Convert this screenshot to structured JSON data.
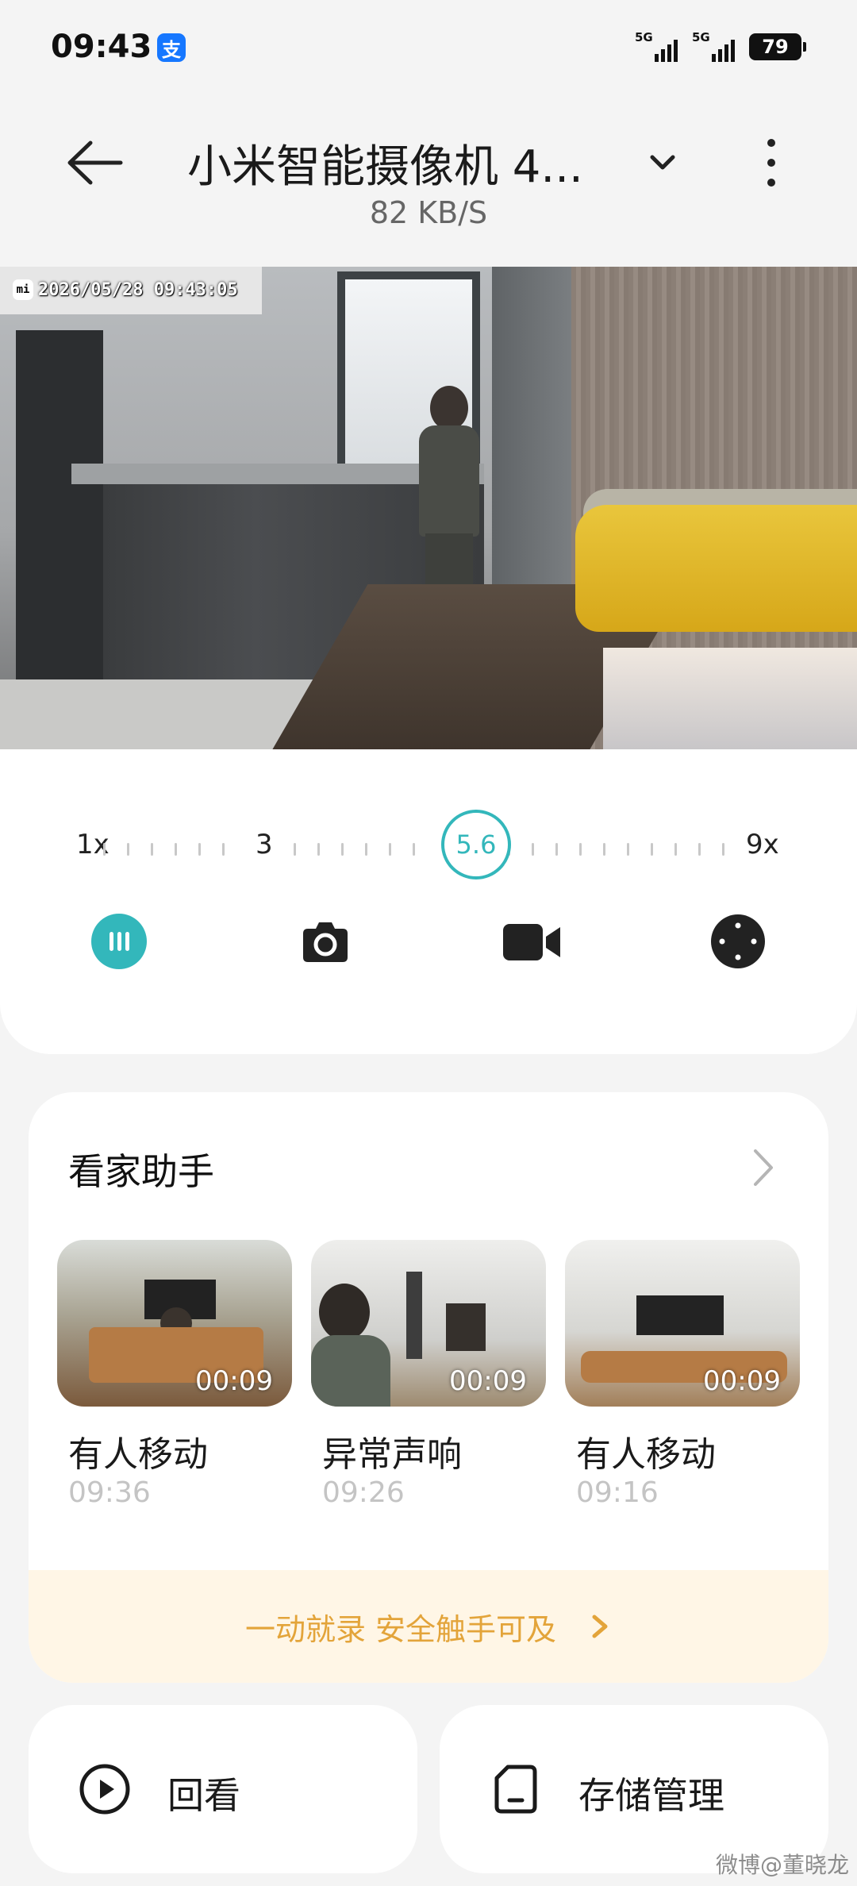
{
  "status_bar": {
    "time": "09:43",
    "app_badge": "支",
    "signal_1": "5G",
    "signal_2": "5G",
    "battery": "79"
  },
  "header": {
    "title": "小米智能摄像机 4...",
    "subtitle": "82 KB/S"
  },
  "camera": {
    "osd_brand": "mi",
    "timestamp": "2026/05/28  09:43:05"
  },
  "zoom": {
    "min_label": "1x",
    "mid_label": "3",
    "current": "5.6",
    "max_label": "9x"
  },
  "controls": {
    "icons": [
      "pause-icon",
      "camera-icon",
      "video-record-icon",
      "dpad-icon"
    ]
  },
  "assistant": {
    "title": "看家助手",
    "clips": [
      {
        "duration": "00:09",
        "label": "有人移动",
        "time": "09:36"
      },
      {
        "duration": "00:09",
        "label": "异常声响",
        "time": "09:26"
      },
      {
        "duration": "00:09",
        "label": "有人移动",
        "time": "09:16"
      }
    ],
    "promo": "一动就录 安全触手可及"
  },
  "bottom": {
    "playback_label": "回看",
    "storage_label": "存储管理"
  },
  "watermark": "微博@董晓龙",
  "colors": {
    "accent": "#33b7bb",
    "promo_text": "#e3a43a",
    "promo_bg": "#fff6e6"
  }
}
